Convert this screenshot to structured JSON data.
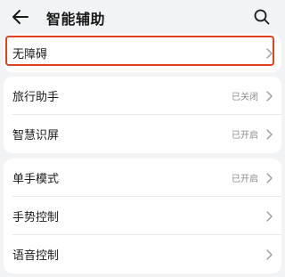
{
  "header": {
    "title": "智能辅助",
    "back_icon": "back-arrow-icon",
    "search_icon": "search-icon"
  },
  "sections": [
    {
      "items": [
        {
          "label": "无障碍",
          "value": ""
        }
      ]
    },
    {
      "items": [
        {
          "label": "旅行助手",
          "value": "已关闭"
        },
        {
          "label": "智慧识屏",
          "value": "已开启"
        }
      ]
    },
    {
      "items": [
        {
          "label": "单手模式",
          "value": "已开启"
        },
        {
          "label": "手势控制",
          "value": ""
        },
        {
          "label": "语音控制",
          "value": ""
        }
      ]
    }
  ],
  "colors": {
    "background": "#f1f3f5",
    "card": "#ffffff",
    "highlight": "#e0421e",
    "secondary_text": "#8a8a8a"
  }
}
